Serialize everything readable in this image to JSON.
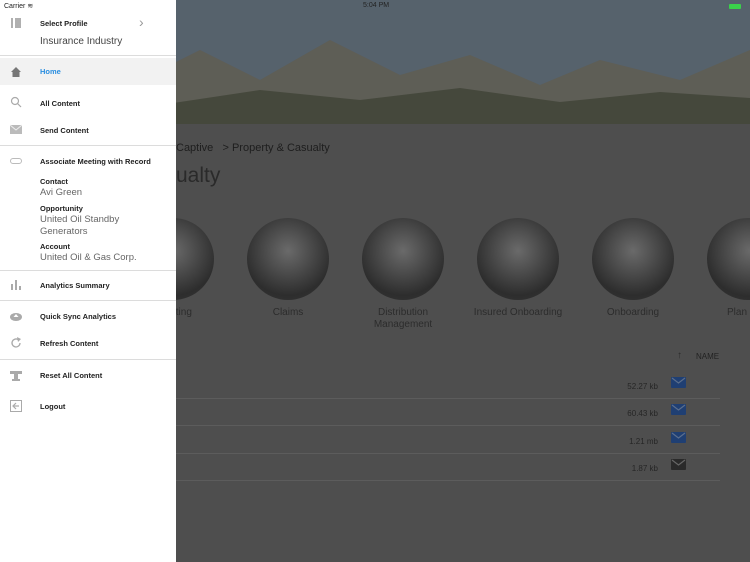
{
  "status_bar": {
    "carrier": "Carrier",
    "time": "5:04 PM"
  },
  "sidebar": {
    "profile": {
      "label": "Select Profile",
      "value": "Insurance Industry"
    },
    "items": [
      {
        "label": "Home",
        "icon": "home-icon",
        "active": true
      },
      {
        "label": "All Content",
        "icon": "search-icon"
      },
      {
        "label": "Send Content",
        "icon": "mail-icon"
      },
      {
        "label": "Associate Meeting with Record",
        "icon": "link-icon"
      },
      {
        "label": "Analytics Summary",
        "icon": "bar-chart-icon"
      },
      {
        "label": "Quick Sync Analytics",
        "icon": "cloud-upload-icon"
      },
      {
        "label": "Refresh Content",
        "icon": "refresh-icon"
      },
      {
        "label": "Reset All Content",
        "icon": "reset-icon"
      },
      {
        "label": "Logout",
        "icon": "logout-icon"
      }
    ],
    "meeting": {
      "contact_label": "Contact",
      "contact": "Avi Green",
      "opportunity_label": "Opportunity",
      "opportunity_line1": "United Oil Standby",
      "opportunity_line2": "Generators",
      "account_label": "Account",
      "account": "United Oil & Gas Corp."
    },
    "accent": "#2a8ee0"
  },
  "main": {
    "breadcrumb": {
      "prev": "Captive",
      "sep": ">",
      "current": "Property & Casualty"
    },
    "title": "ualty",
    "categories": [
      "larketing",
      "Claims",
      "Distribution Management",
      "Insured Onboarding",
      "Onboarding",
      "Plan"
    ],
    "sort_label": "NAME",
    "files": [
      {
        "size": "52.27 kb",
        "mail_color": "#1f3f73"
      },
      {
        "size": "60.43 kb",
        "mail_color": "#1f3f73"
      },
      {
        "size": "1.21 mb",
        "mail_color": "#1f3f73"
      },
      {
        "size": "1.87 kb",
        "mail_color": "#2a2a2a"
      }
    ]
  }
}
